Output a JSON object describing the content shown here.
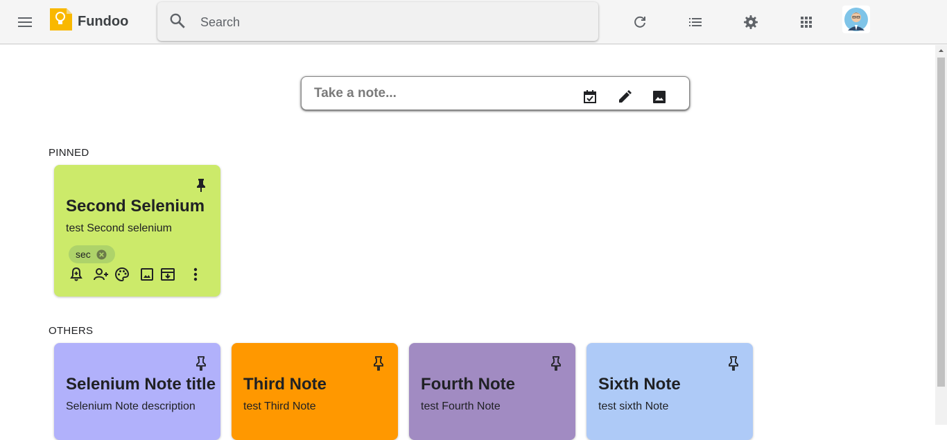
{
  "app": {
    "title": "Fundoo"
  },
  "search": {
    "placeholder": "Search",
    "value": ""
  },
  "take_note": {
    "placeholder": "Take a note...",
    "value": ""
  },
  "sections": {
    "pinned": "PINNED",
    "others": "OTHERS"
  },
  "pinned_notes": [
    {
      "title": "Second Selenium",
      "body": "test Second selenium",
      "label": "sec",
      "color": "#ccea6a"
    }
  ],
  "other_notes": [
    {
      "title": "Selenium Note title",
      "body": "Selenium Note description",
      "color": "#b1b1fb"
    },
    {
      "title": "Third Note",
      "body": "test Third Note",
      "color": "#ff9800"
    },
    {
      "title": "Fourth Note",
      "body": "test Fourth Note",
      "color": "#a18bc2"
    },
    {
      "title": "Sixth Note",
      "body": "test sixth Note",
      "color": "#aecaf7"
    }
  ],
  "icons": {
    "topbar": [
      "menu-icon",
      "bulb-logo",
      "search-icon",
      "refresh-icon",
      "list-view-icon",
      "gear-icon",
      "apps-grid-icon",
      "avatar"
    ],
    "take_note": [
      "checkbox-icon",
      "pencil-icon",
      "image-icon"
    ],
    "note_actions": [
      "reminder-bell-icon",
      "collaborator-icon",
      "palette-icon",
      "image-icon",
      "archive-icon",
      "more-vert-icon"
    ]
  }
}
